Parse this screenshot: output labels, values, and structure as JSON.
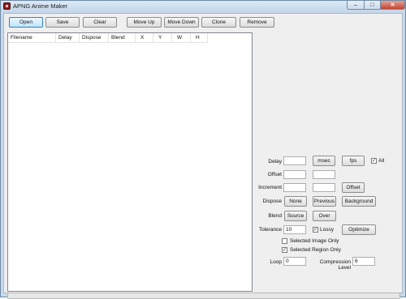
{
  "window": {
    "title": "APNG Anime Maker",
    "min_glyph": "–",
    "max_glyph": "□",
    "close_glyph": "✕"
  },
  "toolbar": {
    "open": "Open",
    "save": "Save",
    "clear": "Clear",
    "move_up": "Move Up",
    "move_down": "Move Down",
    "clone": "Clone",
    "remove": "Remove"
  },
  "frame_list": {
    "columns": [
      "Filename",
      "Delay",
      "Dispose",
      "Blend",
      "X",
      "Y",
      "W",
      "H"
    ]
  },
  "panel": {
    "delay_label": "Delay",
    "delay_value": "",
    "msec_button": "msec",
    "fps_button": "fps",
    "all_checked": true,
    "all_label": "All",
    "offset_label": "Offset",
    "offset_x": "",
    "offset_y": "",
    "increment_label": "Increment",
    "increment_x": "",
    "increment_y": "",
    "offset_button": "Offset",
    "dispose_label": "Dispose",
    "dispose_none": "None",
    "dispose_previous": "Previous",
    "dispose_background": "Background",
    "blend_label": "Blend",
    "blend_source": "Source",
    "blend_over": "Over",
    "tolerance_label": "Tolerance",
    "tolerance_value": "10",
    "lossy_checked": true,
    "lossy_label": "Lossy",
    "optimize_button": "Optimize",
    "selected_image_only_checked": false,
    "selected_image_only_label": "Selected Image Only",
    "selected_region_only_checked": true,
    "selected_region_only_label": "Selected Region Only",
    "loop_label": "Loop",
    "loop_value": "0",
    "compression_label": "Compression Level",
    "compression_value": "6"
  },
  "status": {
    "progress": 0
  }
}
